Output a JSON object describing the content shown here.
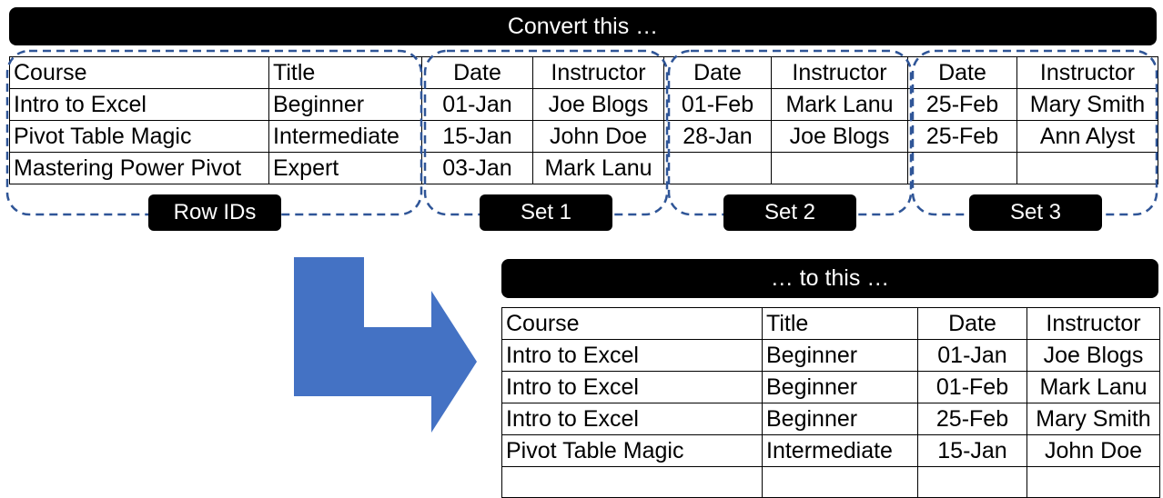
{
  "top_banner": "Convert this …",
  "bottom_banner": "… to this …",
  "group_labels": {
    "row_ids": "Row IDs",
    "set1": "Set 1",
    "set2": "Set 2",
    "set3": "Set 3"
  },
  "source": {
    "header": [
      "Course",
      "Title",
      "Date",
      "Instructor",
      "Date",
      "Instructor",
      "Date",
      "Instructor"
    ],
    "rows": [
      [
        "Intro to Excel",
        "Beginner",
        "01-Jan",
        "Joe Blogs",
        "01-Feb",
        "Mark Lanu",
        "25-Feb",
        "Mary Smith"
      ],
      [
        "Pivot Table Magic",
        "Intermediate",
        "15-Jan",
        "John Doe",
        "28-Jan",
        "Joe Blogs",
        "25-Feb",
        "Ann Alyst"
      ],
      [
        "Mastering Power Pivot",
        "Expert",
        "03-Jan",
        "Mark Lanu",
        "",
        "",
        "",
        ""
      ]
    ]
  },
  "target": {
    "header": [
      "Course",
      "Title",
      "Date",
      "Instructor"
    ],
    "rows": [
      [
        "Intro to Excel",
        "Beginner",
        "01-Jan",
        "Joe Blogs"
      ],
      [
        "Intro to Excel",
        "Beginner",
        "01-Feb",
        "Mark Lanu"
      ],
      [
        "Intro to Excel",
        "Beginner",
        "25-Feb",
        "Mary Smith"
      ],
      [
        "Pivot Table Magic",
        "Intermediate",
        "15-Jan",
        "John Doe"
      ]
    ]
  },
  "colors": {
    "arrow": "#4472C4",
    "dashed_outline": "#2F5597",
    "banner": "#000000"
  }
}
